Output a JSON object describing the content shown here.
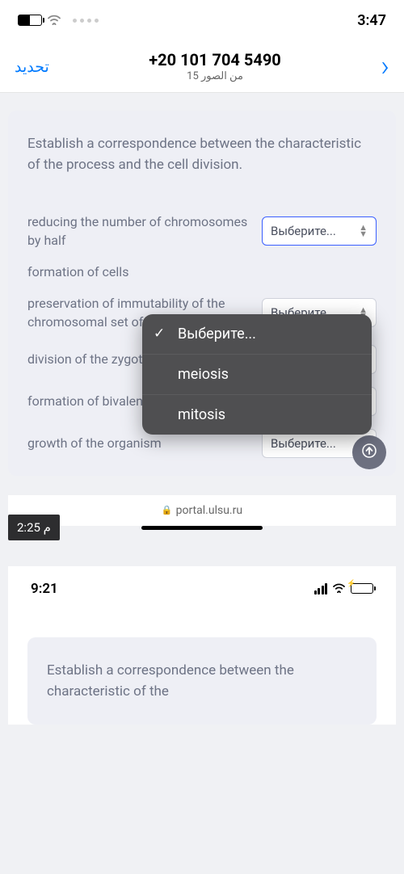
{
  "status": {
    "time": "3:47"
  },
  "nav": {
    "action_label": "تحديد",
    "title": "+20 101 704 5490",
    "subtitle": "15 من الصور"
  },
  "question": "Establish a correspondence between the characteristic of the process and the cell division.",
  "select_placeholder": "Выберите...",
  "rows": [
    {
      "label": "reducing the number of chromosomes by half"
    },
    {
      "label": "formation of cells"
    },
    {
      "label": "preservation of immutability of the chromosomal set of the cell"
    },
    {
      "label": "division of the zygote"
    },
    {
      "label": "formation of bivalents"
    },
    {
      "label": "growth of the organism"
    }
  ],
  "popup": {
    "options": [
      "Выберите...",
      "meiosis",
      "mitosis"
    ]
  },
  "url": "portal.ulsu.ru",
  "video_time": "م 2:25",
  "second": {
    "time": "9:21",
    "question": "Establish a correspondence between the characteristic of the"
  }
}
